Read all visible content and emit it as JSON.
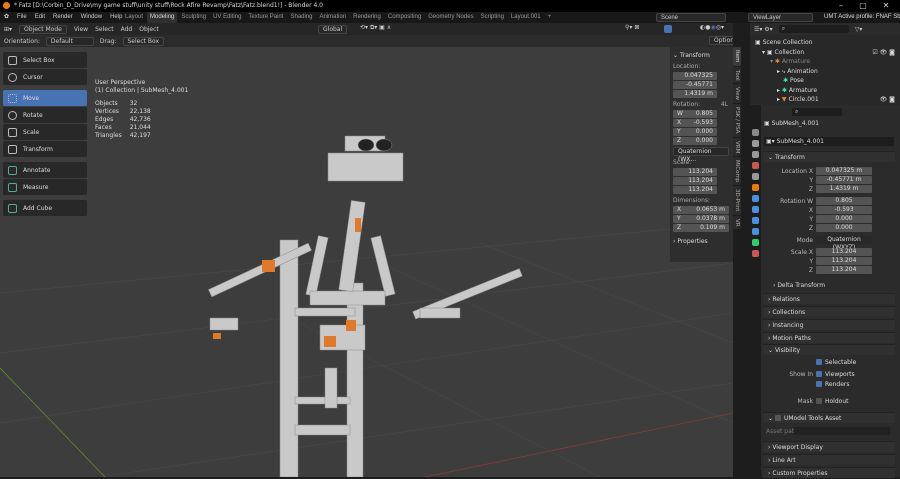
{
  "window": {
    "title": "* Fatz [D:\\Corbin_D_Drive\\my game stuff\\unity stuff\\Rock Afire Revamp\\Fatz\\Fatz.blend1!] - Blender 4.0"
  },
  "menu": [
    "File",
    "Edit",
    "Render",
    "Window",
    "Help"
  ],
  "workspaces": [
    "Layout",
    "Modeling",
    "Sculpting",
    "UV Editing",
    "Texture Paint",
    "Shading",
    "Animation",
    "Rendering",
    "Compositing",
    "Geometry Nodes",
    "Scripting",
    "Layout.001",
    "+"
  ],
  "active_workspace": "Modeling",
  "scene": "Scene",
  "view_layer": "ViewLayer",
  "profile": "UMT Active profile: FNAF Sb",
  "viewport_header": {
    "mode": "Object Mode",
    "menus": [
      "View",
      "Select",
      "Add",
      "Object"
    ],
    "transform_orientation": "Global",
    "options": "Options"
  },
  "tool_settings": {
    "orientation_label": "Orientation:",
    "orientation": "Default",
    "drag_label": "Drag:",
    "drag": "Select Box"
  },
  "tools": [
    "Select Box",
    "Cursor",
    "Move",
    "Rotate",
    "Scale",
    "Transform",
    "Annotate",
    "Measure",
    "Add Cube"
  ],
  "active_tool": "Move",
  "overlay": {
    "view": "User Perspective",
    "context": "(1) Collection | SubMesh_4.001",
    "stats": [
      [
        "Objects",
        "32"
      ],
      [
        "Vertices",
        "22,138"
      ],
      [
        "Edges",
        "42,736"
      ],
      [
        "Faces",
        "21,044"
      ],
      [
        "Triangles",
        "42,197"
      ]
    ]
  },
  "npanel": {
    "header": "Transform",
    "location_label": "Location:",
    "location": [
      "0.047325",
      "-0.45771",
      "1.4319 m"
    ],
    "rotation_label": "Rotation:",
    "rotation_mode_short": "4L",
    "rotation": [
      [
        "W",
        "0.805"
      ],
      [
        "X",
        "-0.593"
      ],
      [
        "Y",
        "0.000"
      ],
      [
        "Z",
        "0.000"
      ]
    ],
    "rotation_mode": "Quaternion (WX...",
    "scale_label": "Scale:",
    "scale": [
      "113.204",
      "113.204",
      "113.204"
    ],
    "dimensions_label": "Dimensions:",
    "dimensions": [
      [
        "X",
        "0.0653 m"
      ],
      [
        "Y",
        "0.0378 m"
      ],
      [
        "Z",
        "0.109 m"
      ]
    ],
    "properties": "Properties",
    "tabs": [
      "Item",
      "Tool",
      "View",
      "PSK / PSA",
      "VRM",
      "MiComp",
      "3D-Print",
      "VR"
    ]
  },
  "outliner": {
    "items": [
      "Scene Collection",
      "Collection",
      "Armature",
      "Animation",
      "Pose",
      "Armature",
      "Circle.001"
    ]
  },
  "properties": {
    "object_name": "SubMesh_4.001",
    "data_name": "SubMesh_4.001",
    "transform": "Transform",
    "location": [
      [
        "Location X",
        "0.047325 m"
      ],
      [
        "Y",
        "-0.45771 m"
      ],
      [
        "Z",
        "1.4319 m"
      ]
    ],
    "rotation": [
      [
        "Rotation W",
        "0.805"
      ],
      [
        "X",
        "-0.593"
      ],
      [
        "Y",
        "0.000"
      ],
      [
        "Z",
        "0.000"
      ]
    ],
    "mode_label": "Mode",
    "mode": "Quaternion (WXYZ)",
    "scale": [
      [
        "Scale X",
        "113.204"
      ],
      [
        "Y",
        "113.204"
      ],
      [
        "Z",
        "113.204"
      ]
    ],
    "delta": "Delta Transform",
    "sections1": [
      "Relations",
      "Collections",
      "Instancing",
      "Motion Paths"
    ],
    "visibility": "Visibility",
    "selectable": "Selectable",
    "show_in": "Show In",
    "viewports": "Viewports",
    "renders": "Renders",
    "mask": "Mask",
    "holdout": "Holdout",
    "umodel": "UModel Tools Asset",
    "asset_path": "Asset path",
    "sections2": [
      "Viewport Display",
      "Line Art",
      "Custom Properties"
    ]
  },
  "colors": {
    "accent": "#4772b3",
    "bg": "#3d3d3d",
    "orange": "#e07a2b"
  }
}
